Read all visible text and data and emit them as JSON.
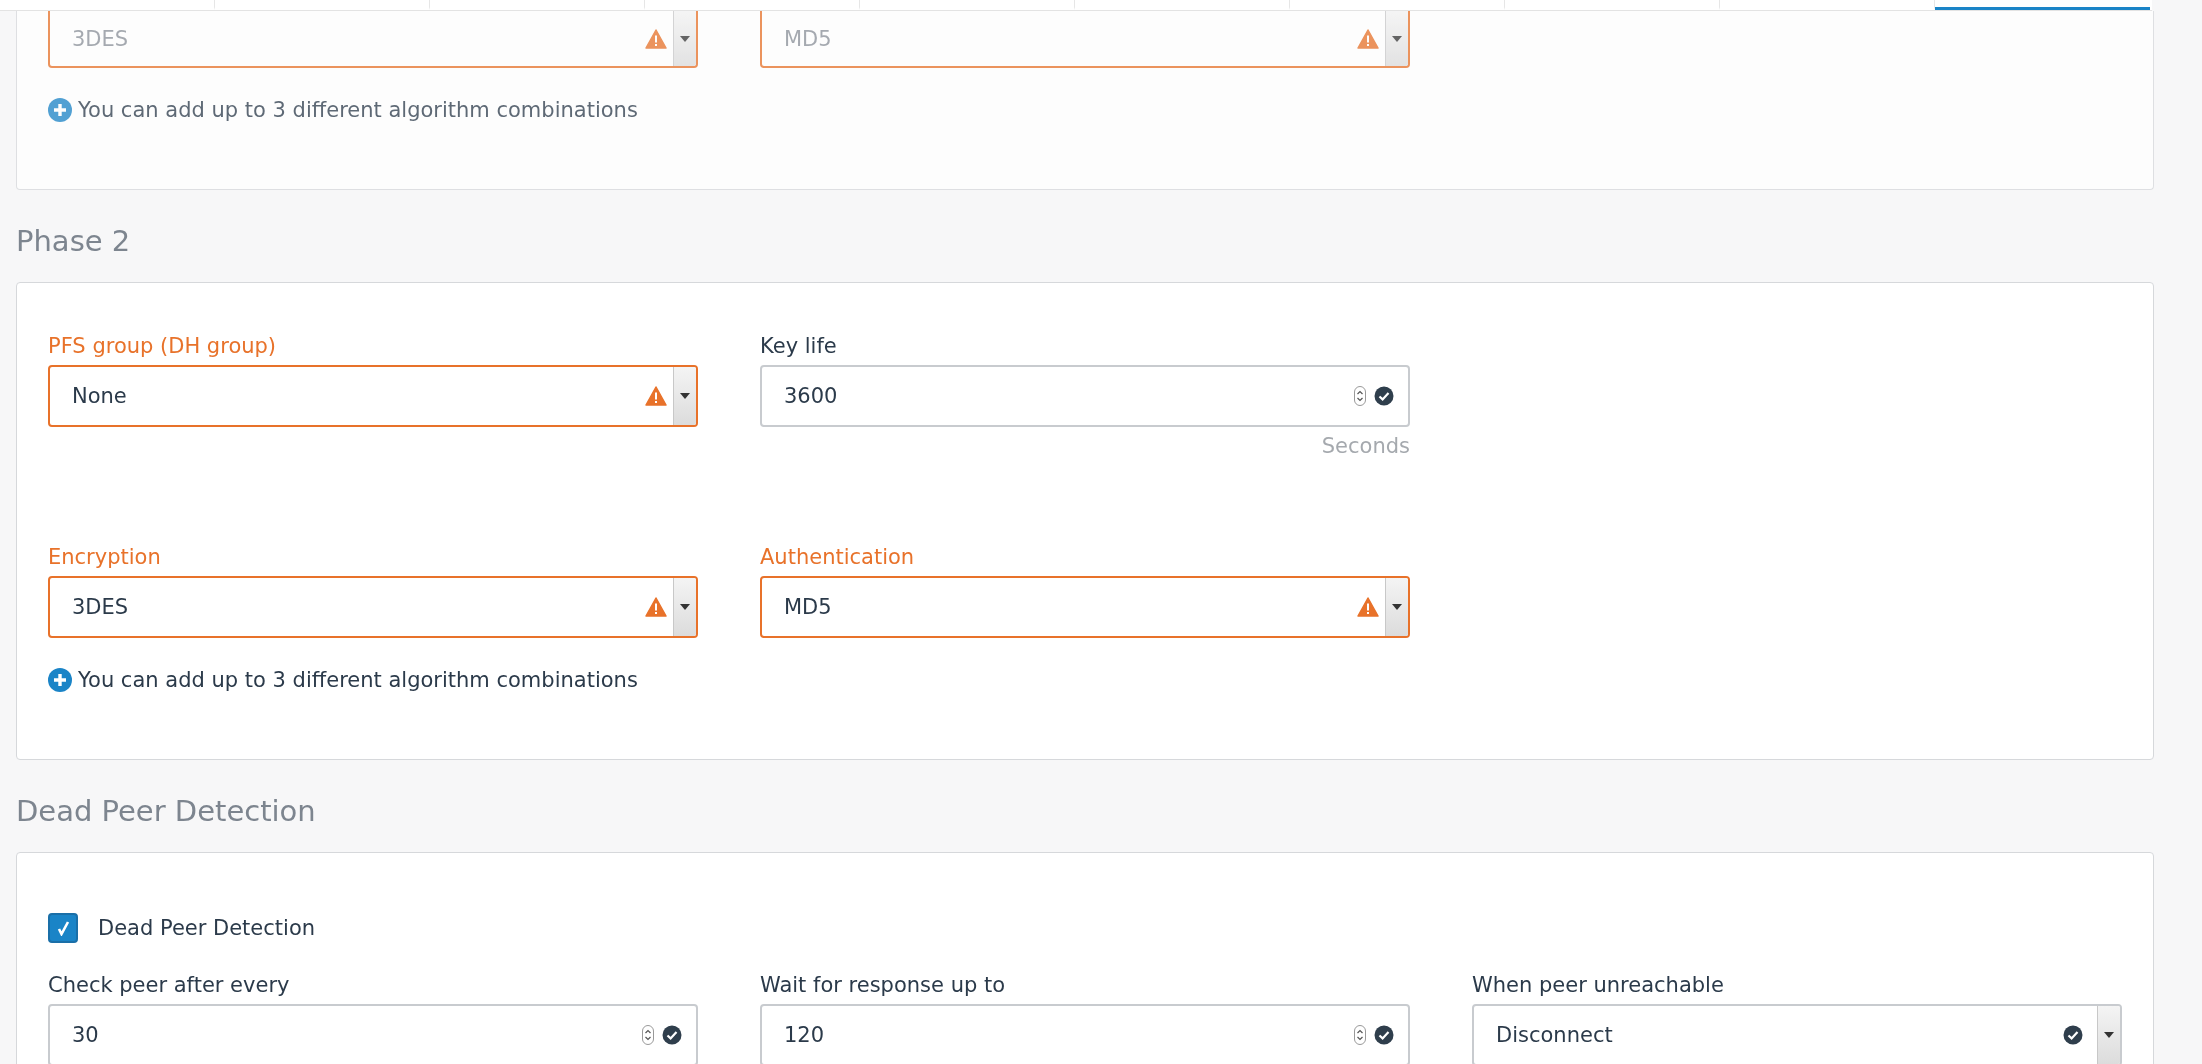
{
  "tab_strip": {
    "tabs": [
      {
        "selected": false
      },
      {
        "selected": false
      },
      {
        "selected": false
      },
      {
        "selected": false
      },
      {
        "selected": false
      },
      {
        "selected": false
      },
      {
        "selected": false
      },
      {
        "selected": false
      },
      {
        "selected": false
      },
      {
        "selected": true
      }
    ]
  },
  "sections": [
    {
      "faded": true,
      "rows": [
        {
          "fields": [
            {
              "kind": "select",
              "value": "3DES",
              "warning": true,
              "valid": false
            },
            {
              "kind": "select",
              "value": "MD5",
              "warning": true,
              "valid": false
            }
          ]
        }
      ],
      "add_note": "You can add up to 3 different algorithm combinations"
    },
    {
      "heading": "Phase 2",
      "faded": false,
      "rows": [
        {
          "fields": [
            {
              "kind": "select",
              "label": "PFS group (DH group)",
              "value": "None",
              "warning": true,
              "valid": false
            },
            {
              "kind": "number",
              "label": "Key life",
              "value": "3600",
              "warning": false,
              "valid": true,
              "unit": "Seconds"
            }
          ]
        },
        {
          "fields": [
            {
              "kind": "select",
              "label": "Encryption",
              "value": "3DES",
              "warning": true,
              "valid": false
            },
            {
              "kind": "select",
              "label": "Authentication",
              "value": "MD5",
              "warning": true,
              "valid": false
            }
          ]
        }
      ],
      "add_note": "You can add up to 3 different algorithm combinations"
    },
    {
      "heading": "Dead Peer Detection",
      "faded": false,
      "checkbox": {
        "label": "Dead Peer Detection",
        "checked": true
      },
      "rows": [
        {
          "fields": [
            {
              "kind": "number",
              "label": "Check peer after every",
              "value": "30",
              "warning": false,
              "valid": true
            },
            {
              "kind": "number",
              "label": "Wait for response up to",
              "value": "120",
              "warning": false,
              "valid": true
            },
            {
              "kind": "select",
              "label": "When peer unreachable",
              "value": "Disconnect",
              "warning": false,
              "valid": true
            }
          ]
        }
      ]
    }
  ]
}
